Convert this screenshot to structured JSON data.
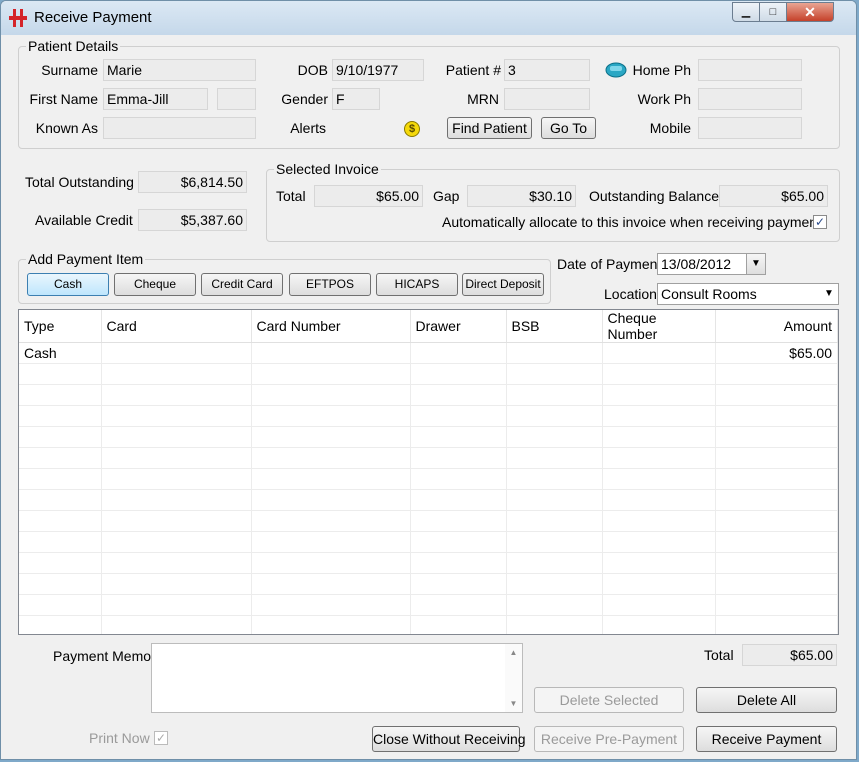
{
  "window": {
    "title": "Receive Payment",
    "min": "▁",
    "max": "□",
    "close": "✕"
  },
  "patient": {
    "group_title": "Patient Details",
    "surname_label": "Surname",
    "surname": "Marie",
    "firstname_label": "First Name",
    "firstname": "Emma-Jill",
    "middle": "",
    "knownas_label": "Known As",
    "knownas": "",
    "dob_label": "DOB",
    "dob": "9/10/1977",
    "gender_label": "Gender",
    "gender": "F",
    "alerts_label": "Alerts",
    "alerts_icon": "$",
    "patientno_label": "Patient #",
    "patientno": "3",
    "mrn_label": "MRN",
    "mrn": "",
    "find_patient": "Find Patient",
    "go_to": "Go To",
    "homeph_label": "Home Ph",
    "homeph": "",
    "workph_label": "Work Ph",
    "workph": "",
    "mobile_label": "Mobile",
    "mobile": ""
  },
  "totals": {
    "outstanding_label": "Total Outstanding",
    "outstanding": "$6,814.50",
    "credit_label": "Available Credit",
    "credit": "$5,387.60"
  },
  "invoice": {
    "group_title": "Selected Invoice",
    "total_label": "Total",
    "total": "$65.00",
    "gap_label": "Gap",
    "gap": "$30.10",
    "balance_label": "Outstanding Balance",
    "balance": "$65.00",
    "auto_label": "Automatically allocate to this invoice when receiving payment",
    "auto_checked": "✓"
  },
  "payment_item": {
    "group_title": "Add Payment Item",
    "buttons": [
      "Cash",
      "Cheque",
      "Credit Card",
      "EFTPOS",
      "HICAPS",
      "Direct Deposit"
    ]
  },
  "date_label": "Date of Payment",
  "date": "13/08/2012",
  "location_label": "Location",
  "location": "Consult Rooms",
  "grid": {
    "columns": [
      "Type",
      "Card",
      "Card Number",
      "Drawer",
      "BSB",
      "Cheque Number",
      "Amount"
    ],
    "rows": [
      [
        "Cash",
        "",
        "",
        "",
        "",
        "",
        "$65.00"
      ]
    ]
  },
  "footer": {
    "memo_label": "Payment Memo",
    "memo": "",
    "total_label": "Total",
    "total": "$65.00",
    "delete_selected": "Delete Selected",
    "delete_all": "Delete All",
    "print_now_label": "Print Now",
    "print_now_checked": "✓",
    "close_without": "Close Without Receiving",
    "receive_pre": "Receive Pre-Payment",
    "receive": "Receive Payment"
  }
}
